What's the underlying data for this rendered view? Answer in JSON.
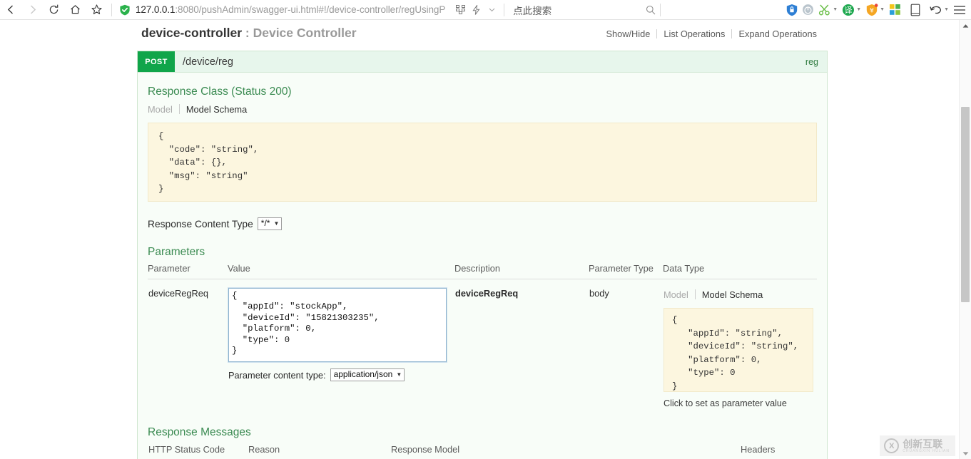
{
  "browser": {
    "nav": {
      "back": "back-arrow",
      "forward": "forward-arrow",
      "reload": "reload-icon",
      "home": "home-icon",
      "bookmark": "star-icon"
    },
    "url": {
      "host": "127.0.0.1",
      "rest": ":8080/pushAdmin/swagger-ui.html#!/device-controller/regUsingP",
      "security_icon": "shield-check-icon",
      "apps_icon": "apps-grid-icon",
      "lightning_icon": "lightning-icon",
      "chevron_icon": "chevron-down-icon"
    },
    "search": {
      "placeholder": "点此搜索",
      "icon": "search-icon"
    },
    "tools": [
      {
        "name": "shield-security-icon",
        "glyph": "⛨"
      },
      {
        "name": "globe-icon",
        "glyph": "●"
      },
      {
        "name": "scissors-capture-icon",
        "glyph": "✂"
      },
      {
        "name": "translate-icon",
        "glyph": "译"
      },
      {
        "name": "wallet-shield-icon",
        "glyph": "¥"
      },
      {
        "name": "apps-grid-icon",
        "glyph": "■"
      },
      {
        "name": "mobile-view-icon",
        "glyph": "□"
      },
      {
        "name": "undo-icon",
        "glyph": "↺"
      },
      {
        "name": "menu-icon",
        "glyph": "≡"
      }
    ]
  },
  "resource": {
    "name": "device-controller",
    "separator": " : ",
    "description": "Device Controller",
    "links": [
      "Show/Hide",
      "List Operations",
      "Expand Operations"
    ]
  },
  "operation": {
    "method": "POST",
    "path": "/device/reg",
    "nickname": "reg",
    "response_class": {
      "title": "Response Class (Status 200)",
      "tabs": [
        "Model",
        "Model Schema"
      ],
      "active_tab": "Model Schema",
      "schema": "{\n  \"code\": \"string\",\n  \"data\": {},\n  \"msg\": \"string\"\n}"
    },
    "response_content_type": {
      "label": "Response Content Type",
      "value": "*/*"
    },
    "parameters": {
      "title": "Parameters",
      "headers": [
        "Parameter",
        "Value",
        "Description",
        "Parameter Type",
        "Data Type"
      ],
      "rows": [
        {
          "parameter": "deviceRegReq",
          "value": "{\n  \"appId\": \"stockApp\",\n  \"deviceId\": \"15821303235\",\n  \"platform\": 0,\n  \"type\": 0\n}",
          "description": "deviceRegReq",
          "parameter_type": "body",
          "content_type_label": "Parameter content type:",
          "content_type_value": "application/json",
          "data_type": {
            "tabs": [
              "Model",
              "Model Schema"
            ],
            "active_tab": "Model Schema",
            "schema": "{\n   \"appId\": \"string\",\n   \"deviceId\": \"string\",\n   \"platform\": 0,\n   \"type\": 0\n}",
            "hint": "Click to set as parameter value"
          }
        }
      ]
    },
    "response_messages": {
      "title": "Response Messages",
      "headers": [
        "HTTP Status Code",
        "Reason",
        "Response Model",
        "Headers"
      ]
    }
  },
  "watermark": {
    "mark": "X",
    "text": "创新互联",
    "sub": "CHUANGXIN HULIAN"
  },
  "colors": {
    "method_green": "#10a54a",
    "header_green": "#e7f6ec",
    "panel_green": "#f8fdf8",
    "schema_yellow": "#fcf6df",
    "title_green": "#3b8b52"
  }
}
